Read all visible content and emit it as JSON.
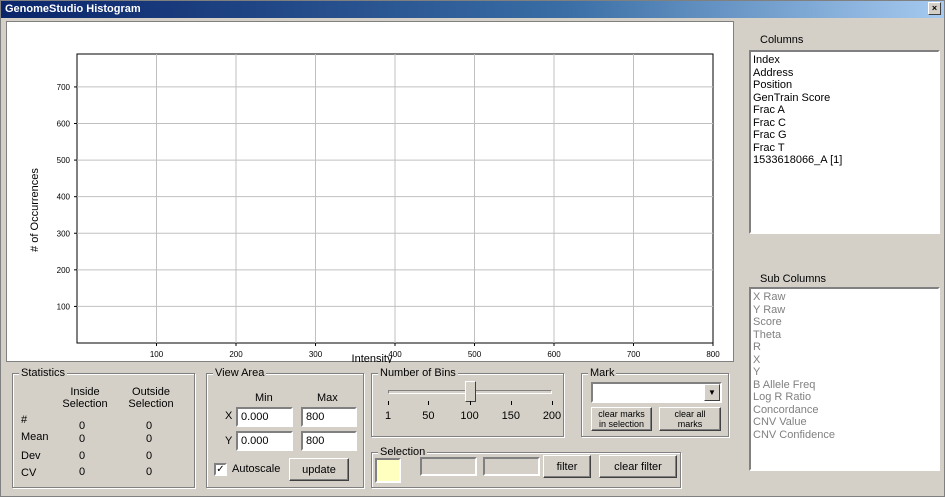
{
  "window": {
    "title": "GenomeStudio Histogram",
    "close_glyph": "×"
  },
  "chart_data": {
    "type": "bar",
    "title": "",
    "xlabel": "Intensity",
    "ylabel": "# of Occurrences",
    "xlim": [
      0,
      800
    ],
    "ylim": [
      0,
      790
    ],
    "xticks": [
      100,
      200,
      300,
      400,
      500,
      600,
      700,
      800
    ],
    "yticks": [
      100,
      200,
      300,
      400,
      500,
      600,
      700
    ],
    "grid": true,
    "series": []
  },
  "columns": {
    "title": "Columns",
    "items": [
      "Index",
      "Address",
      "Position",
      "GenTrain Score",
      "Frac A",
      "Frac C",
      "Frac G",
      "Frac T",
      "1533618066_A [1]"
    ]
  },
  "sub_columns": {
    "title": "Sub Columns",
    "items": [
      "X Raw",
      "Y Raw",
      "Score",
      "Theta",
      "R",
      "X",
      "Y",
      "B Allele Freq",
      "Log R Ratio",
      "Concordance",
      "CNV Value",
      "CNV Confidence"
    ]
  },
  "statistics": {
    "title": "Statistics",
    "col_inside": "Inside Selection",
    "col_outside": "Outside Selection",
    "rows": [
      {
        "label": "#",
        "inside": "0",
        "outside": "0"
      },
      {
        "label": "Mean",
        "inside": "0",
        "outside": "0"
      },
      {
        "label": "Dev",
        "inside": "0",
        "outside": "0"
      },
      {
        "label": "CV",
        "inside": "0",
        "outside": "0"
      }
    ]
  },
  "view_area": {
    "title": "View Area",
    "min_label": "Min",
    "max_label": "Max",
    "x_label": "X",
    "y_label": "Y",
    "x_min": "0.000",
    "x_max": "800",
    "y_min": "0.000",
    "y_max": "800",
    "autoscale_label": "Autoscale",
    "autoscale_checked": true,
    "autoscale_mark": "✓",
    "update_label": "update"
  },
  "bins": {
    "title": "Number of Bins",
    "value": 100,
    "min": 1,
    "max": 200,
    "tick_labels": [
      "1",
      "50",
      "100",
      "150",
      "200"
    ]
  },
  "mark": {
    "title": "Mark",
    "selected": "",
    "dropdown_glyph": "▼",
    "clear_in_selection_line1": "clear marks",
    "clear_in_selection_line2": "in selection",
    "clear_all_line1": "clear all",
    "clear_all_line2": "marks"
  },
  "selection": {
    "title": "Selection",
    "swatch_color": "#ffffc0",
    "filter_label": "filter",
    "clear_filter_label": "clear filter"
  }
}
